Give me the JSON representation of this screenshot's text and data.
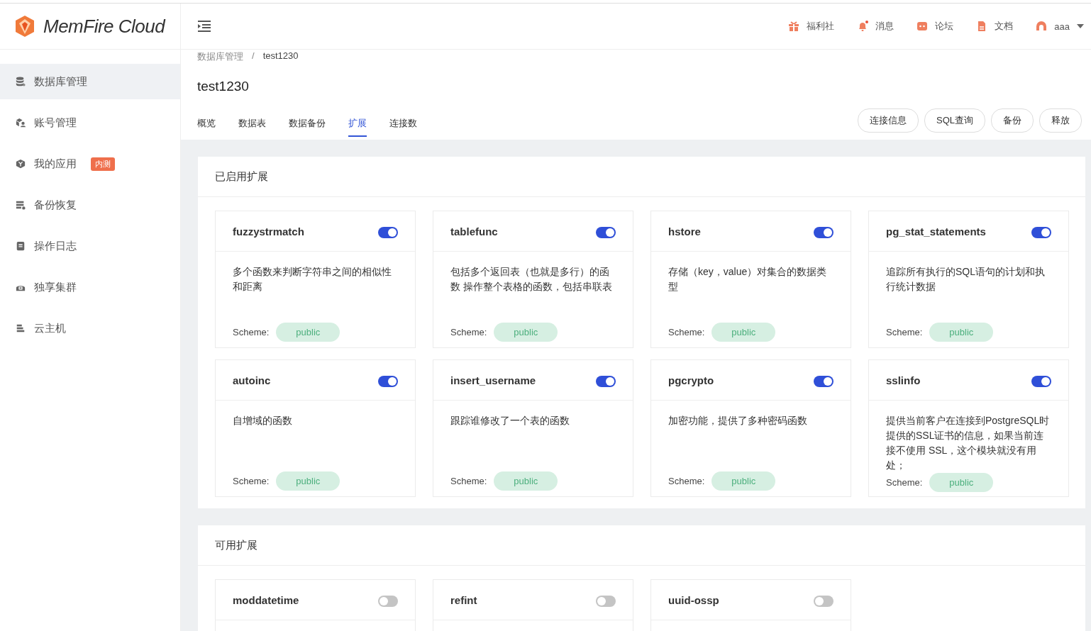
{
  "logo": {
    "text": "MemFire Cloud"
  },
  "sidebar": {
    "items": [
      {
        "label": "数据库管理",
        "selected": true
      },
      {
        "label": "账号管理",
        "selected": false
      },
      {
        "label": "我的应用",
        "selected": false,
        "badge": "内测"
      },
      {
        "label": "备份恢复",
        "selected": false
      },
      {
        "label": "操作日志",
        "selected": false
      },
      {
        "label": "独享集群",
        "selected": false
      },
      {
        "label": "云主机",
        "selected": false
      }
    ]
  },
  "header": {
    "links": [
      {
        "label": "福利社"
      },
      {
        "label": "消息"
      },
      {
        "label": "论坛"
      },
      {
        "label": "文档"
      }
    ],
    "user": "aaa"
  },
  "breadcrumb": [
    "数据库管理",
    "/",
    "test1230"
  ],
  "title": "test1230",
  "tabs": [
    {
      "label": "概览",
      "selected": false
    },
    {
      "label": "数据表",
      "selected": false
    },
    {
      "label": "数据备份",
      "selected": false
    },
    {
      "label": "扩展",
      "selected": true
    },
    {
      "label": "连接数",
      "selected": false
    }
  ],
  "actions": [
    "连接信息",
    "SQL查询",
    "备份",
    "释放"
  ],
  "sections": [
    {
      "title": "已启用扩展",
      "extensions": [
        {
          "name": "fuzzystrmatch",
          "on": true,
          "description": "多个函数来判断字符串之间的相似性和距离",
          "scheme_label": "Scheme:",
          "scheme": "public"
        },
        {
          "name": "tablefunc",
          "on": true,
          "description": "包括多个返回表（也就是多行）的函数 操作整个表格的函数，包括串联表",
          "scheme_label": "Scheme:",
          "scheme": "public"
        },
        {
          "name": "hstore",
          "on": true,
          "description": "存储（key，value）对集合的数据类型",
          "scheme_label": "Scheme:",
          "scheme": "public"
        },
        {
          "name": "pg_stat_statements",
          "on": true,
          "description": "追踪所有执行的SQL语句的计划和执行统计数据",
          "scheme_label": "Scheme:",
          "scheme": "public"
        },
        {
          "name": "autoinc",
          "on": true,
          "description": "自增域的函数",
          "scheme_label": "Scheme:",
          "scheme": "public"
        },
        {
          "name": "insert_username",
          "on": true,
          "description": "跟踪谁修改了一个表的函数",
          "scheme_label": "Scheme:",
          "scheme": "public"
        },
        {
          "name": "pgcrypto",
          "on": true,
          "description": "加密功能，提供了多种密码函数",
          "scheme_label": "Scheme:",
          "scheme": "public"
        },
        {
          "name": "sslinfo",
          "on": true,
          "description": "提供当前客户在连接到PostgreSQL时提供的SSL证书的信息，如果当前连接不使用 SSL，这个模块就没有用处；",
          "scheme_label": "Scheme:",
          "scheme": "public"
        }
      ]
    },
    {
      "title": "可用扩展",
      "extensions": [
        {
          "name": "moddatetime",
          "on": false
        },
        {
          "name": "refint",
          "on": false
        },
        {
          "name": "uuid-ossp",
          "on": false
        }
      ]
    }
  ]
}
